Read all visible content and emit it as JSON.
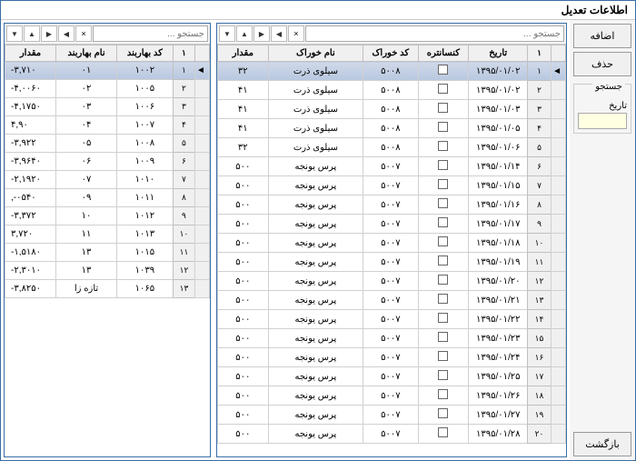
{
  "window_title": "اطلاعات تعدیل",
  "sidebar": {
    "add_label": "اضافه",
    "delete_label": "حذف",
    "search_group_label": "جستجو",
    "date_label": "تاریخ",
    "back_label": "بازگشت"
  },
  "toolbar": {
    "search_placeholder": "جستجو ..."
  },
  "right_grid": {
    "headers": {
      "rownum": "۱",
      "date": "تاریخ",
      "kons": "کنسانتره",
      "code": "کد خوراک",
      "name": "نام خوراک",
      "qty": "مقدار"
    },
    "rows": [
      {
        "n": "۱",
        "date": "۱۳۹۵/۰۱/۰۲",
        "code": "۵۰۰۸",
        "name": "سیلوی ذرت",
        "qty": "۳۲",
        "sel": true
      },
      {
        "n": "۲",
        "date": "۱۳۹۵/۰۱/۰۲",
        "code": "۵۰۰۸",
        "name": "سیلوی ذرت",
        "qty": "۴۱"
      },
      {
        "n": "۳",
        "date": "۱۳۹۵/۰۱/۰۳",
        "code": "۵۰۰۸",
        "name": "سیلوی ذرت",
        "qty": "۴۱"
      },
      {
        "n": "۴",
        "date": "۱۳۹۵/۰۱/۰۵",
        "code": "۵۰۰۸",
        "name": "سیلوی ذرت",
        "qty": "۴۱"
      },
      {
        "n": "۵",
        "date": "۱۳۹۵/۰۱/۰۶",
        "code": "۵۰۰۸",
        "name": "سیلوی ذرت",
        "qty": "۳۲"
      },
      {
        "n": "۶",
        "date": "۱۳۹۵/۰۱/۱۴",
        "code": "۵۰۰۷",
        "name": "پرس یونجه",
        "qty": "۵۰۰"
      },
      {
        "n": "۷",
        "date": "۱۳۹۵/۰۱/۱۵",
        "code": "۵۰۰۷",
        "name": "پرس یونجه",
        "qty": "۵۰۰"
      },
      {
        "n": "۸",
        "date": "۱۳۹۵/۰۱/۱۶",
        "code": "۵۰۰۷",
        "name": "پرس یونجه",
        "qty": "۵۰۰"
      },
      {
        "n": "۹",
        "date": "۱۳۹۵/۰۱/۱۷",
        "code": "۵۰۰۷",
        "name": "پرس یونجه",
        "qty": "۵۰۰"
      },
      {
        "n": "۱۰",
        "date": "۱۳۹۵/۰۱/۱۸",
        "code": "۵۰۰۷",
        "name": "پرس یونجه",
        "qty": "۵۰۰"
      },
      {
        "n": "۱۱",
        "date": "۱۳۹۵/۰۱/۱۹",
        "code": "۵۰۰۷",
        "name": "پرس یونجه",
        "qty": "۵۰۰"
      },
      {
        "n": "۱۲",
        "date": "۱۳۹۵/۰۱/۲۰",
        "code": "۵۰۰۷",
        "name": "پرس یونجه",
        "qty": "۵۰۰"
      },
      {
        "n": "۱۳",
        "date": "۱۳۹۵/۰۱/۲۱",
        "code": "۵۰۰۷",
        "name": "پرس یونجه",
        "qty": "۵۰۰"
      },
      {
        "n": "۱۴",
        "date": "۱۳۹۵/۰۱/۲۲",
        "code": "۵۰۰۷",
        "name": "پرس یونجه",
        "qty": "۵۰۰"
      },
      {
        "n": "۱۵",
        "date": "۱۳۹۵/۰۱/۲۳",
        "code": "۵۰۰۷",
        "name": "پرس یونجه",
        "qty": "۵۰۰"
      },
      {
        "n": "۱۶",
        "date": "۱۳۹۵/۰۱/۲۴",
        "code": "۵۰۰۷",
        "name": "پرس یونجه",
        "qty": "۵۰۰"
      },
      {
        "n": "۱۷",
        "date": "۱۳۹۵/۰۱/۲۵",
        "code": "۵۰۰۷",
        "name": "پرس یونجه",
        "qty": "۵۰۰"
      },
      {
        "n": "۱۸",
        "date": "۱۳۹۵/۰۱/۲۶",
        "code": "۵۰۰۷",
        "name": "پرس یونجه",
        "qty": "۵۰۰"
      },
      {
        "n": "۱۹",
        "date": "۱۳۹۵/۰۱/۲۷",
        "code": "۵۰۰۷",
        "name": "پرس یونجه",
        "qty": "۵۰۰"
      },
      {
        "n": "۲۰",
        "date": "۱۳۹۵/۰۱/۲۸",
        "code": "۵۰۰۷",
        "name": "پرس یونجه",
        "qty": "۵۰۰"
      }
    ]
  },
  "left_grid": {
    "headers": {
      "rownum": "۱",
      "code": "کد بهاربند",
      "name": "نام بهاربند",
      "qty": "مقدار"
    },
    "rows": [
      {
        "n": "۱",
        "code": "۱۰۰۲",
        "name": "۰۱",
        "qty": "۳,۷۱۰-",
        "sel": true
      },
      {
        "n": "۲",
        "code": "۱۰۰۵",
        "name": "۰۲",
        "qty": "۴,۰۰۶۰-"
      },
      {
        "n": "۳",
        "code": "۱۰۰۶",
        "name": "۰۳",
        "qty": "۴,۱۷۵۰-"
      },
      {
        "n": "۴",
        "code": "۱۰۰۷",
        "name": "۰۴",
        "qty": "۴,۹۰"
      },
      {
        "n": "۵",
        "code": "۱۰۰۸",
        "name": "۰۵",
        "qty": "۳,۹۲۲-"
      },
      {
        "n": "۶",
        "code": "۱۰۰۹",
        "name": "۰۶",
        "qty": "۳,۹۶۴۰-"
      },
      {
        "n": "۷",
        "code": "۱۰۱۰",
        "name": "۰۷",
        "qty": "۲,۱۹۲۰-"
      },
      {
        "n": "۸",
        "code": "۱۰۱۱",
        "name": "۰۹",
        "qty": "۰۵۴۰-,"
      },
      {
        "n": "۹",
        "code": "۱۰۱۲",
        "name": "۱۰",
        "qty": "۳,۳۷۲-"
      },
      {
        "n": "۱۰",
        "code": "۱۰۱۳",
        "name": "۱۱",
        "qty": "۳,۷۲۰"
      },
      {
        "n": "۱۱",
        "code": "۱۰۱۵",
        "name": "۱۳",
        "qty": "۱,۵۱۸۰-"
      },
      {
        "n": "۱۲",
        "code": "۱۰۳۹",
        "name": "۱۳",
        "qty": "۲,۳۰۱۰-"
      },
      {
        "n": "۱۳",
        "code": "۱۰۶۵",
        "name": "تازه زا",
        "qty": "۳,۸۲۵۰-"
      }
    ]
  }
}
